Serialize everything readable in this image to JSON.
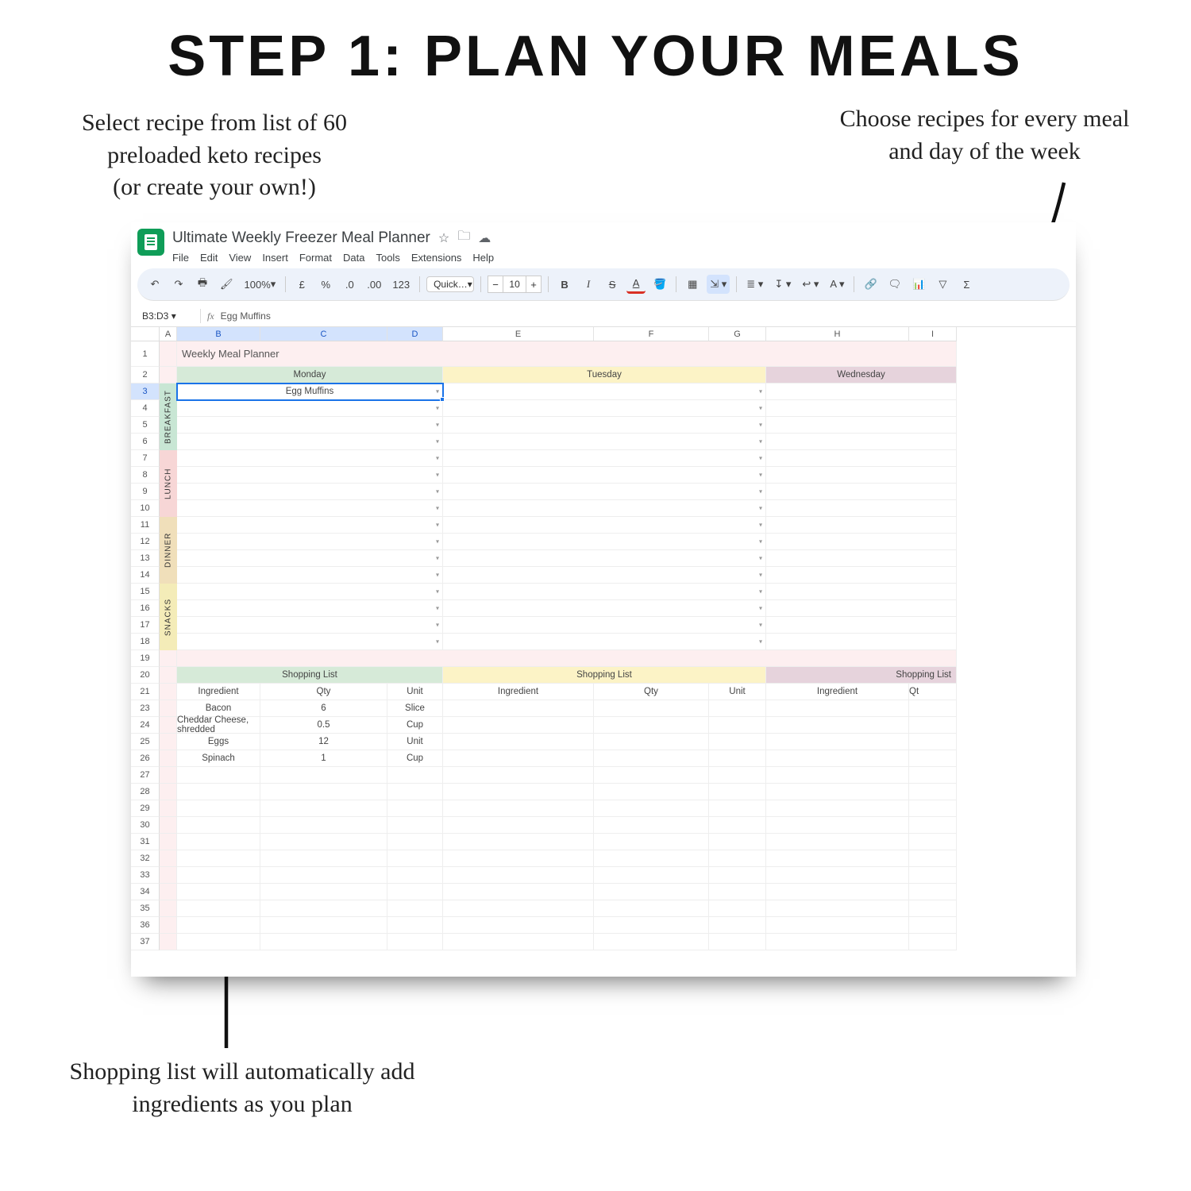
{
  "page_title": "STEP 1: PLAN YOUR MEALS",
  "annotations": {
    "left": "Select recipe from list of 60 preloaded keto recipes\n(or create your own!)",
    "right": "Choose recipes for every meal and day of the week",
    "bottom": "Shopping list will automatically add ingredients as you plan"
  },
  "doc": {
    "title": "Ultimate Weekly Freezer Meal Planner",
    "menus": [
      "File",
      "Edit",
      "View",
      "Insert",
      "Format",
      "Data",
      "Tools",
      "Extensions",
      "Help"
    ]
  },
  "toolbar": {
    "zoom": "100%",
    "currency": "£",
    "percent": "%",
    "dec_dec": ".0",
    "inc_dec": ".00",
    "num_fmt": "123",
    "font": "Quick…",
    "font_size": "10"
  },
  "namebox": {
    "ref": "B3:D3",
    "formula": "Egg Muffins"
  },
  "columns": [
    "A",
    "B",
    "C",
    "D",
    "E",
    "F",
    "G",
    "H",
    "I"
  ],
  "row_numbers": [
    1,
    2,
    3,
    4,
    5,
    6,
    7,
    8,
    9,
    10,
    11,
    12,
    13,
    14,
    15,
    16,
    17,
    18,
    19,
    20,
    21,
    23,
    24,
    25,
    26,
    27,
    28,
    29,
    30,
    31,
    32,
    33,
    34,
    35,
    36,
    37
  ],
  "planner": {
    "title": "Weekly Meal Planner",
    "days": {
      "mon": "Monday",
      "tue": "Tuesday",
      "wed": "Wednesday"
    },
    "categories": {
      "breakfast": "BREAKFAST",
      "lunch": "LUNCH",
      "dinner": "DINNER",
      "snacks": "SNACKS"
    },
    "selected_recipe": "Egg Muffins"
  },
  "shopping": {
    "header": "Shopping List",
    "columns": {
      "ingredient": "Ingredient",
      "qty": "Qty",
      "unit": "Unit"
    },
    "items": [
      {
        "ingredient": "Bacon",
        "qty": "6",
        "unit": "Slice"
      },
      {
        "ingredient": "Cheddar Cheese, shredded",
        "qty": "0.5",
        "unit": "Cup"
      },
      {
        "ingredient": "Eggs",
        "qty": "12",
        "unit": "Unit"
      },
      {
        "ingredient": "Spinach",
        "qty": "1",
        "unit": "Cup"
      }
    ]
  }
}
